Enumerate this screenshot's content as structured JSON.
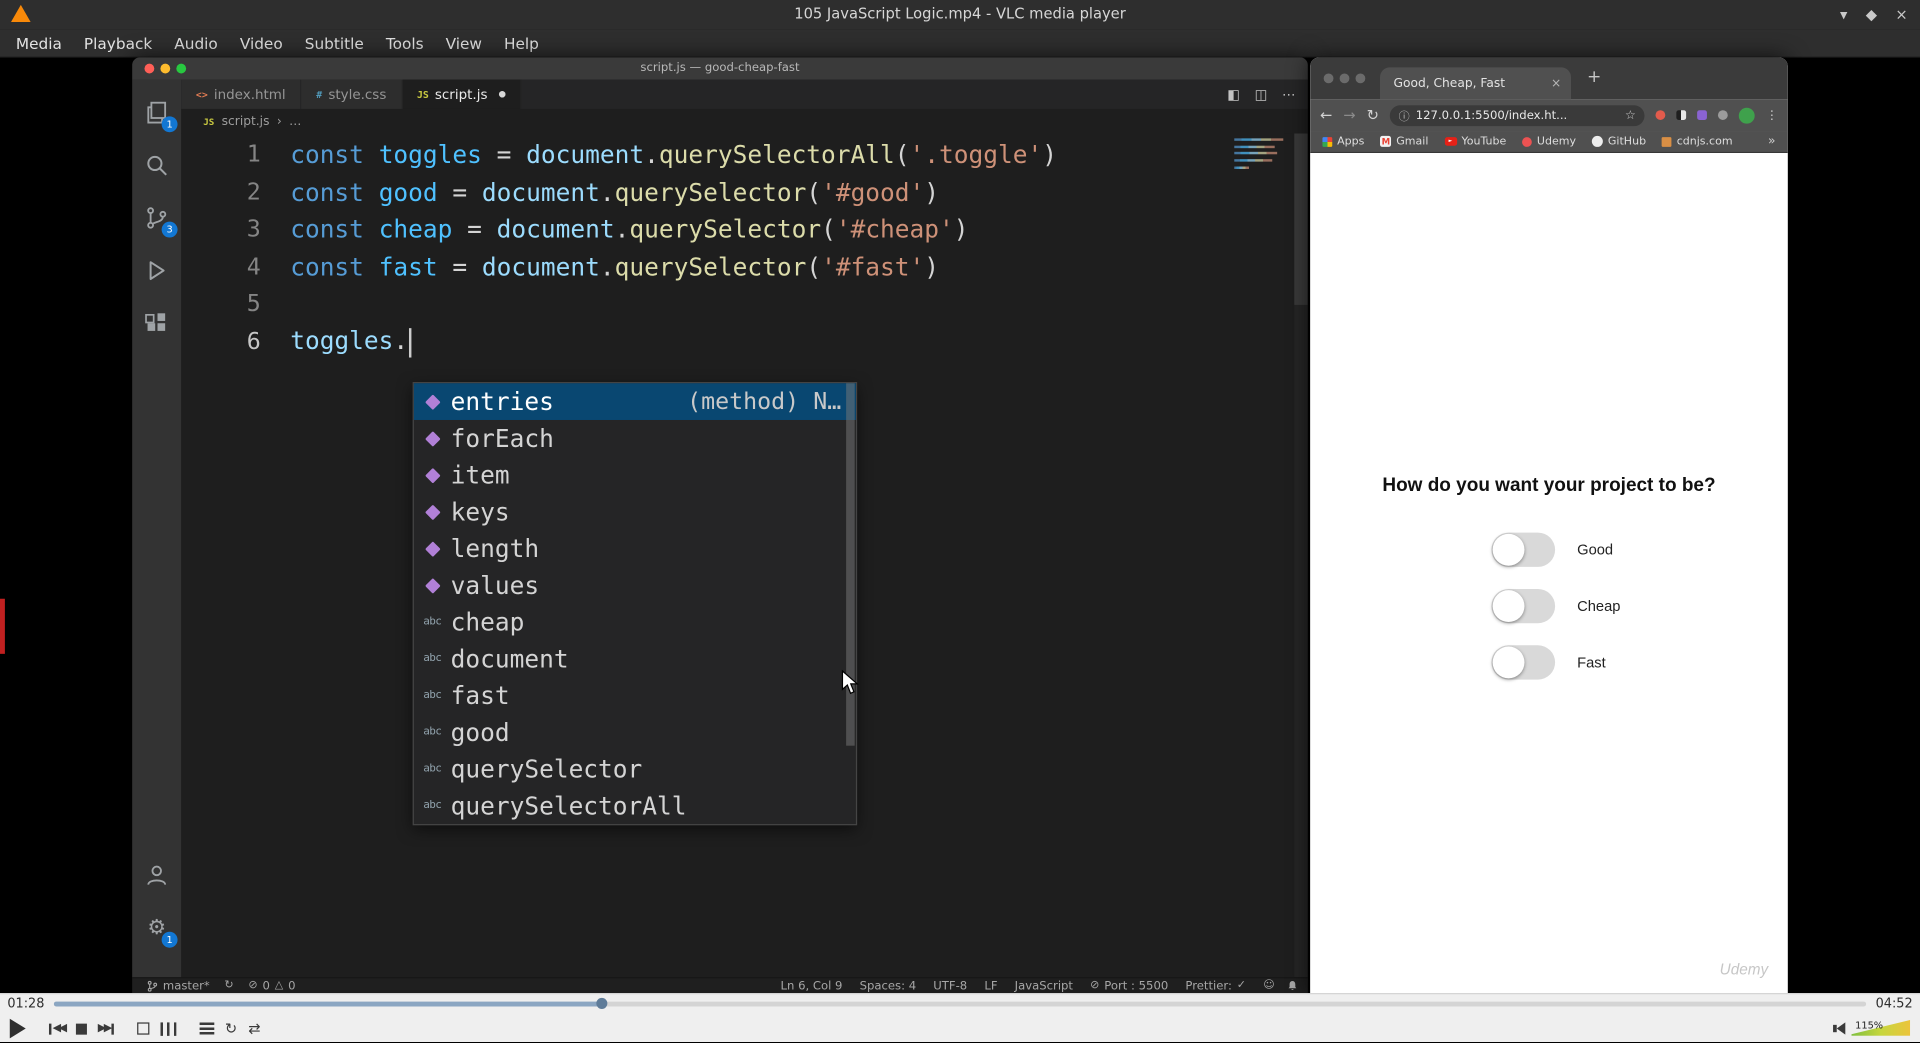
{
  "colors": {
    "selection_blue": "#094771",
    "badge_blue": "#1277d3",
    "vlc_orange": "#f88909",
    "string_orange": "#ce9178",
    "keyword_blue": "#569cd6"
  },
  "icons": {
    "shade": "▾",
    "maximize": "◆",
    "close": "×",
    "back": "←",
    "forward": "→",
    "reload": "↻",
    "star": "☆",
    "info": "ⓘ",
    "tab_close": "×",
    "new_tab": "+",
    "menu_dots": "⋮",
    "changes": "◧",
    "split": "◫",
    "more": "⋯",
    "bc_sep": "›",
    "sync": "↻",
    "error": "⊘",
    "warning": "△",
    "port": "⊘",
    "check": "✓",
    "smiley": "☺",
    "loop": "↻",
    "shuffle": "⇄",
    "overflow": "»",
    "modified_dot": "●"
  },
  "vlc": {
    "window_title": "105 JavaScript Logic.mp4 - VLC media player",
    "menu": [
      "Media",
      "Playback",
      "Audio",
      "Video",
      "Subtitle",
      "Tools",
      "View",
      "Help"
    ],
    "elapsed": "01:28",
    "duration": "04:52",
    "volume": "115%",
    "progress_pct": 30.2
  },
  "vscode": {
    "window_title": "script.js — good-cheap-fast",
    "tabs": [
      {
        "label": "index.html",
        "kind": "html",
        "active": false,
        "modified": false
      },
      {
        "label": "style.css",
        "kind": "css",
        "active": false,
        "modified": false
      },
      {
        "label": "script.js",
        "kind": "js",
        "active": true,
        "modified": true
      }
    ],
    "breadcrumb": {
      "file": "script.js",
      "more": "…"
    },
    "activity_badges": {
      "explorer": "1",
      "scm": "3",
      "settings": "1"
    },
    "code": [
      {
        "n": "1",
        "t": [
          [
            "kw",
            "const"
          ],
          [
            "pl",
            " "
          ],
          [
            "def",
            "toggles"
          ],
          [
            "pl",
            " "
          ],
          [
            "op",
            "="
          ],
          [
            "pl",
            " "
          ],
          [
            "var",
            "document"
          ],
          [
            "op",
            "."
          ],
          [
            "fn",
            "querySelectorAll"
          ],
          [
            "br",
            "("
          ],
          [
            "str",
            "'.toggle'"
          ],
          [
            "br",
            ")"
          ]
        ]
      },
      {
        "n": "2",
        "t": [
          [
            "kw",
            "const"
          ],
          [
            "pl",
            " "
          ],
          [
            "def",
            "good"
          ],
          [
            "pl",
            " "
          ],
          [
            "op",
            "="
          ],
          [
            "pl",
            " "
          ],
          [
            "var",
            "document"
          ],
          [
            "op",
            "."
          ],
          [
            "fn",
            "querySelector"
          ],
          [
            "br",
            "("
          ],
          [
            "str",
            "'#good'"
          ],
          [
            "br",
            ")"
          ]
        ]
      },
      {
        "n": "3",
        "t": [
          [
            "kw",
            "const"
          ],
          [
            "pl",
            " "
          ],
          [
            "def",
            "cheap"
          ],
          [
            "pl",
            " "
          ],
          [
            "op",
            "="
          ],
          [
            "pl",
            " "
          ],
          [
            "var",
            "document"
          ],
          [
            "op",
            "."
          ],
          [
            "fn",
            "querySelector"
          ],
          [
            "br",
            "("
          ],
          [
            "str",
            "'#cheap'"
          ],
          [
            "br",
            ")"
          ]
        ]
      },
      {
        "n": "4",
        "t": [
          [
            "kw",
            "const"
          ],
          [
            "pl",
            " "
          ],
          [
            "def",
            "fast"
          ],
          [
            "pl",
            " "
          ],
          [
            "op",
            "="
          ],
          [
            "pl",
            " "
          ],
          [
            "var",
            "document"
          ],
          [
            "op",
            "."
          ],
          [
            "fn",
            "querySelector"
          ],
          [
            "br",
            "("
          ],
          [
            "str",
            "'#fast'"
          ],
          [
            "br",
            ")"
          ]
        ]
      },
      {
        "n": "5",
        "t": []
      },
      {
        "n": "6",
        "t": [
          [
            "var",
            "toggles"
          ],
          [
            "op",
            "."
          ],
          [
            "cursor",
            ""
          ]
        ]
      }
    ],
    "suggest": [
      {
        "label": "entries",
        "kind": "method",
        "detail": "(method) N…",
        "selected": true
      },
      {
        "label": "forEach",
        "kind": "method"
      },
      {
        "label": "item",
        "kind": "method"
      },
      {
        "label": "keys",
        "kind": "method"
      },
      {
        "label": "length",
        "kind": "method"
      },
      {
        "label": "values",
        "kind": "method"
      },
      {
        "label": "cheap",
        "kind": "text"
      },
      {
        "label": "document",
        "kind": "text"
      },
      {
        "label": "fast",
        "kind": "text"
      },
      {
        "label": "good",
        "kind": "text"
      },
      {
        "label": "querySelector",
        "kind": "text"
      },
      {
        "label": "querySelectorAll",
        "kind": "text"
      }
    ],
    "status": {
      "branch": "master*",
      "errors": "0",
      "warnings": "0",
      "right": [
        {
          "label": "Ln 6, Col 9"
        },
        {
          "label": "Spaces: 4"
        },
        {
          "label": "UTF-8"
        },
        {
          "label": "LF"
        },
        {
          "label": "JavaScript"
        },
        {
          "label": "Port : 5500",
          "icon": "port"
        },
        {
          "label": "Prettier:",
          "check": true
        }
      ]
    }
  },
  "chrome": {
    "tab_title": "Good, Cheap, Fast",
    "url": "127.0.0.1:5500/index.ht...",
    "bookmarks": [
      {
        "label": "Apps",
        "icon": "apps"
      },
      {
        "label": "Gmail",
        "icon": "gmail"
      },
      {
        "label": "YouTube",
        "icon": "youtube"
      },
      {
        "label": "Udemy",
        "icon": "udemy"
      },
      {
        "label": "GitHub",
        "icon": "github"
      },
      {
        "label": "cdnjs.com",
        "icon": "cdnjs"
      }
    ],
    "page": {
      "heading": "How do you want your project to be?",
      "toggles": [
        {
          "label": "Good",
          "on": false
        },
        {
          "label": "Cheap",
          "on": false
        },
        {
          "label": "Fast",
          "on": false
        }
      ],
      "watermark": "Udemy"
    }
  }
}
